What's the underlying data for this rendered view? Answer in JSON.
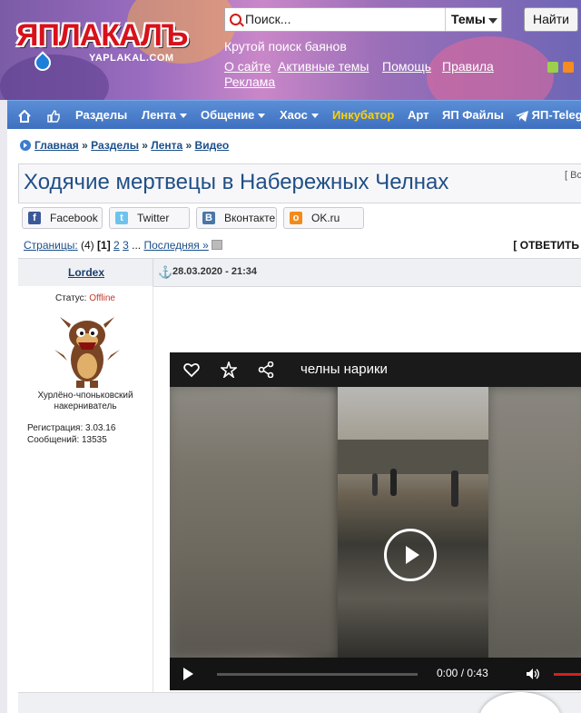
{
  "header": {
    "logo_text": "ЯПЛАКАЛЪ",
    "logo_sub": "YAPLAKAL.COM",
    "tagline": "Крутой поиск баянов",
    "links": [
      "О сайте",
      "Активные темы",
      "Помощь",
      "Правила",
      "Реклама"
    ]
  },
  "search": {
    "placeholder": "Поиск...",
    "scope": "Темы",
    "button": "Найти"
  },
  "nav": {
    "items": [
      "Разделы",
      "Лента",
      "Общение",
      "Хаос",
      "Инкубатор",
      "Арт",
      "ЯП Файлы",
      "ЯП-Teleg"
    ],
    "highlight_color": "#ffd200"
  },
  "breadcrumb": [
    "Главная",
    "Разделы",
    "Лента",
    "Видео"
  ],
  "topic": {
    "title": "Ходячие мертвецы в Набережных Челнах",
    "side": "[ Вс"
  },
  "share": [
    "Facebook",
    "Twitter",
    "Вконтакте",
    "OK.ru"
  ],
  "pagination": {
    "label": "Страницы:",
    "count": "(4)",
    "current": "[1]",
    "pages": [
      "2",
      "3"
    ],
    "ellipsis": "...",
    "last": "Последняя »",
    "reply": "[ ОТВЕТИТЬ"
  },
  "post": {
    "author": "Lordex",
    "date": "28.03.2020 - 21:34",
    "status_label": "Статус:",
    "status_value": "Offline",
    "user_title": "Хурлёно-чпоньковский накерниватель",
    "registered": "Регистрация: 3.03.16",
    "posts": "Сообщений: 13535"
  },
  "video": {
    "title": "челны нарики",
    "current_time": "0:00",
    "separator": "/",
    "duration": "0:43"
  }
}
